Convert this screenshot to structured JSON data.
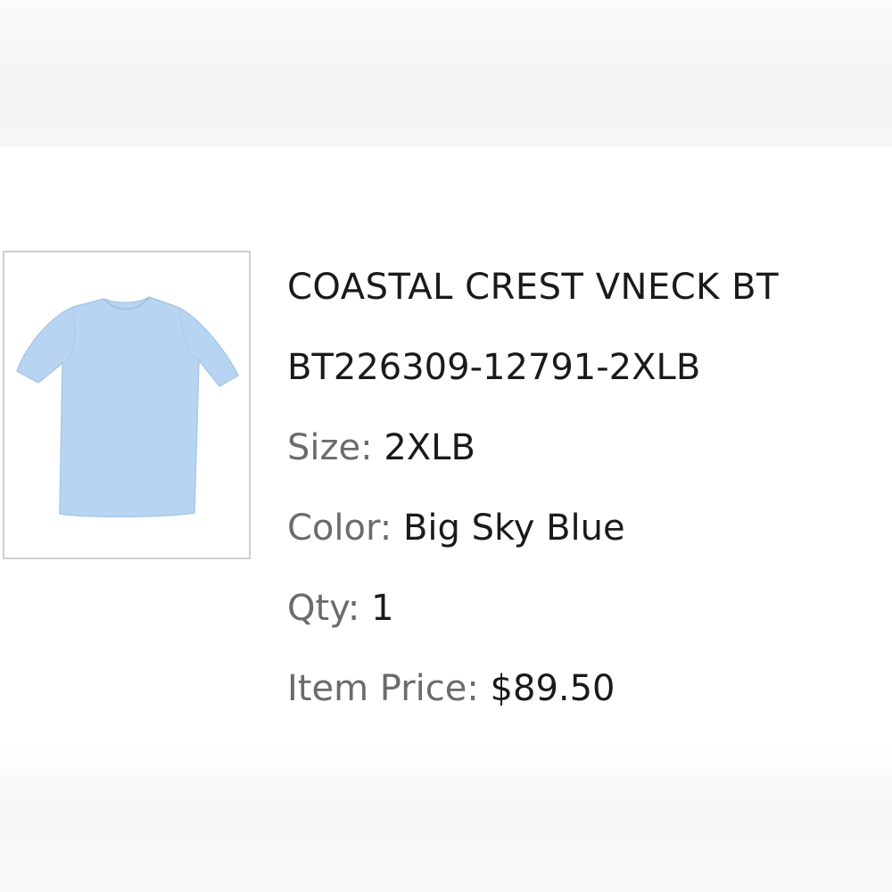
{
  "product": {
    "name": "COASTAL CREST VNECK BT",
    "sku": "BT226309-12791-2XLB",
    "size_label": "Size:",
    "size_value": "2XLB",
    "color_label": "Color:",
    "color_value": "Big Sky Blue",
    "qty_label": "Qty:",
    "qty_value": "1",
    "price_label": "Item Price:",
    "price_value": "$89.50",
    "thumbnail_icon": "tshirt-icon",
    "shirt_color": "#b7d5f3"
  }
}
